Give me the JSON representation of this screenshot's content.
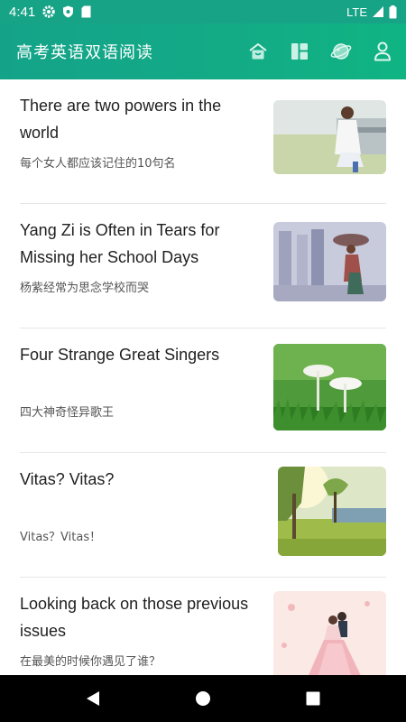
{
  "status_bar": {
    "time": "4:41",
    "network": "LTE",
    "icons": [
      "gear-icon",
      "shield-icon",
      "sd-card-icon",
      "signal-icon",
      "battery-icon"
    ]
  },
  "app_bar": {
    "title": "高考英语双语阅读",
    "actions": [
      "home-icon",
      "dashboard-icon",
      "planet-icon",
      "user-icon"
    ],
    "accent_color": "#14a389"
  },
  "articles": [
    {
      "title": "There are two powers in the world",
      "subtitle": " 每个女人都应该记住的10句名",
      "image": "woman-sitting-on-bench-photo"
    },
    {
      "title": "Yang Zi is Often in Tears for Missing her School Days",
      "subtitle": "杨紫经常为思念学校而哭",
      "image": "girl-in-rain-photo"
    },
    {
      "title": "Four Strange Great Singers",
      "subtitle": "四大神奇怪异歌王",
      "image": "white-mushrooms-in-grass-photo"
    },
    {
      "title": "Vitas? Vitas?",
      "subtitle": "Vitas？Vitas！",
      "image": "sunlit-trees-landscape-photo"
    },
    {
      "title": "Looking back on those previous issues",
      "subtitle": "在最美的时候你遇见了谁？",
      "image": "wedding-couple-illustration"
    }
  ],
  "nav_bar": {
    "buttons": [
      "back-icon",
      "home-circle-icon",
      "recents-square-icon"
    ]
  }
}
